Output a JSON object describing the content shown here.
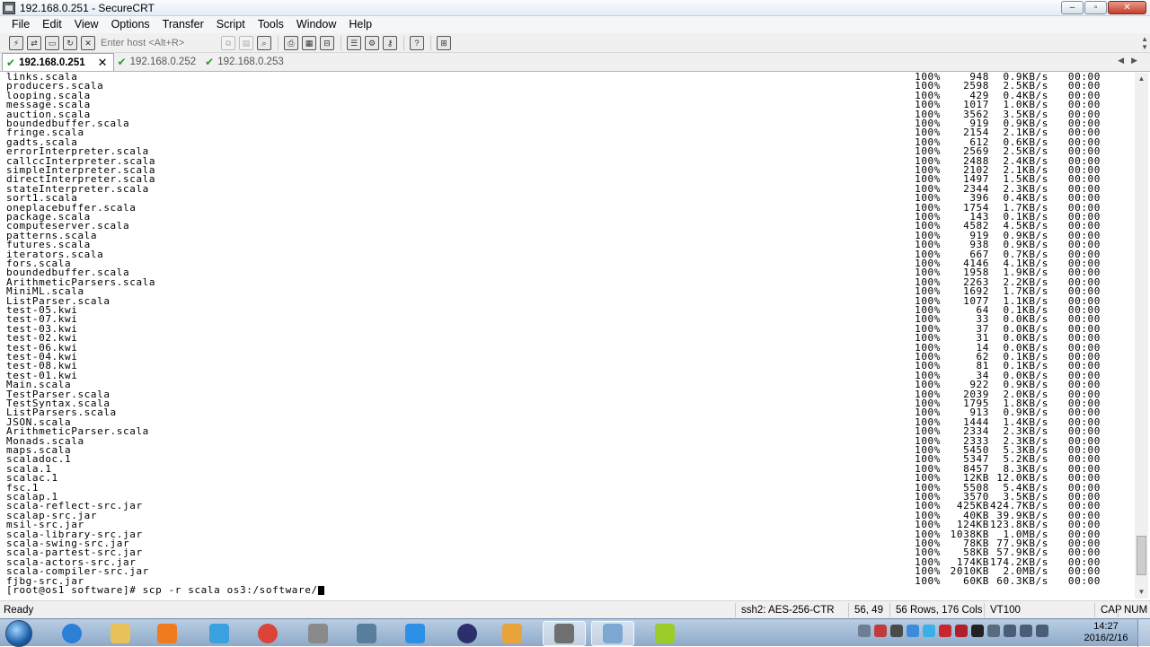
{
  "window": {
    "title": "192.168.0.251 - SecureCRT",
    "min": "–",
    "max": "▫",
    "close": "✕"
  },
  "menu": [
    "File",
    "Edit",
    "View",
    "Options",
    "Transfer",
    "Script",
    "Tools",
    "Window",
    "Help"
  ],
  "toolbar": {
    "host_placeholder": "Enter host <Alt+R>"
  },
  "tabs": [
    {
      "label": "192.168.0.251",
      "active": true
    },
    {
      "label": "192.168.0.252",
      "active": false
    },
    {
      "label": "192.168.0.253",
      "active": false
    }
  ],
  "terminal": {
    "rows": [
      {
        "file": "links.scala",
        "pct": "100%",
        "size": "948",
        "rate": "0.9KB/s",
        "eta": "00:00"
      },
      {
        "file": "producers.scala",
        "pct": "100%",
        "size": "2598",
        "rate": "2.5KB/s",
        "eta": "00:00"
      },
      {
        "file": "looping.scala",
        "pct": "100%",
        "size": "429",
        "rate": "0.4KB/s",
        "eta": "00:00"
      },
      {
        "file": "message.scala",
        "pct": "100%",
        "size": "1017",
        "rate": "1.0KB/s",
        "eta": "00:00"
      },
      {
        "file": "auction.scala",
        "pct": "100%",
        "size": "3562",
        "rate": "3.5KB/s",
        "eta": "00:00"
      },
      {
        "file": "boundedbuffer.scala",
        "pct": "100%",
        "size": "919",
        "rate": "0.9KB/s",
        "eta": "00:00"
      },
      {
        "file": "fringe.scala",
        "pct": "100%",
        "size": "2154",
        "rate": "2.1KB/s",
        "eta": "00:00"
      },
      {
        "file": "gadts.scala",
        "pct": "100%",
        "size": "612",
        "rate": "0.6KB/s",
        "eta": "00:00"
      },
      {
        "file": "errorInterpreter.scala",
        "pct": "100%",
        "size": "2569",
        "rate": "2.5KB/s",
        "eta": "00:00"
      },
      {
        "file": "callccInterpreter.scala",
        "pct": "100%",
        "size": "2488",
        "rate": "2.4KB/s",
        "eta": "00:00"
      },
      {
        "file": "simpleInterpreter.scala",
        "pct": "100%",
        "size": "2102",
        "rate": "2.1KB/s",
        "eta": "00:00"
      },
      {
        "file": "directInterpreter.scala",
        "pct": "100%",
        "size": "1497",
        "rate": "1.5KB/s",
        "eta": "00:00"
      },
      {
        "file": "stateInterpreter.scala",
        "pct": "100%",
        "size": "2344",
        "rate": "2.3KB/s",
        "eta": "00:00"
      },
      {
        "file": "sort1.scala",
        "pct": "100%",
        "size": "396",
        "rate": "0.4KB/s",
        "eta": "00:00"
      },
      {
        "file": "oneplacebuffer.scala",
        "pct": "100%",
        "size": "1754",
        "rate": "1.7KB/s",
        "eta": "00:00"
      },
      {
        "file": "package.scala",
        "pct": "100%",
        "size": "143",
        "rate": "0.1KB/s",
        "eta": "00:00"
      },
      {
        "file": "computeserver.scala",
        "pct": "100%",
        "size": "4582",
        "rate": "4.5KB/s",
        "eta": "00:00"
      },
      {
        "file": "patterns.scala",
        "pct": "100%",
        "size": "919",
        "rate": "0.9KB/s",
        "eta": "00:00"
      },
      {
        "file": "futures.scala",
        "pct": "100%",
        "size": "938",
        "rate": "0.9KB/s",
        "eta": "00:00"
      },
      {
        "file": "iterators.scala",
        "pct": "100%",
        "size": "667",
        "rate": "0.7KB/s",
        "eta": "00:00"
      },
      {
        "file": "fors.scala",
        "pct": "100%",
        "size": "4146",
        "rate": "4.1KB/s",
        "eta": "00:00"
      },
      {
        "file": "boundedbuffer.scala",
        "pct": "100%",
        "size": "1958",
        "rate": "1.9KB/s",
        "eta": "00:00"
      },
      {
        "file": "ArithmeticParsers.scala",
        "pct": "100%",
        "size": "2263",
        "rate": "2.2KB/s",
        "eta": "00:00"
      },
      {
        "file": "MiniML.scala",
        "pct": "100%",
        "size": "1692",
        "rate": "1.7KB/s",
        "eta": "00:00"
      },
      {
        "file": "ListParser.scala",
        "pct": "100%",
        "size": "1077",
        "rate": "1.1KB/s",
        "eta": "00:00"
      },
      {
        "file": "test-05.kwi",
        "pct": "100%",
        "size": "64",
        "rate": "0.1KB/s",
        "eta": "00:00"
      },
      {
        "file": "test-07.kwi",
        "pct": "100%",
        "size": "33",
        "rate": "0.0KB/s",
        "eta": "00:00"
      },
      {
        "file": "test-03.kwi",
        "pct": "100%",
        "size": "37",
        "rate": "0.0KB/s",
        "eta": "00:00"
      },
      {
        "file": "test-02.kwi",
        "pct": "100%",
        "size": "31",
        "rate": "0.0KB/s",
        "eta": "00:00"
      },
      {
        "file": "test-06.kwi",
        "pct": "100%",
        "size": "14",
        "rate": "0.0KB/s",
        "eta": "00:00"
      },
      {
        "file": "test-04.kwi",
        "pct": "100%",
        "size": "62",
        "rate": "0.1KB/s",
        "eta": "00:00"
      },
      {
        "file": "test-08.kwi",
        "pct": "100%",
        "size": "81",
        "rate": "0.1KB/s",
        "eta": "00:00"
      },
      {
        "file": "test-01.kwi",
        "pct": "100%",
        "size": "34",
        "rate": "0.0KB/s",
        "eta": "00:00"
      },
      {
        "file": "Main.scala",
        "pct": "100%",
        "size": "922",
        "rate": "0.9KB/s",
        "eta": "00:00"
      },
      {
        "file": "TestParser.scala",
        "pct": "100%",
        "size": "2039",
        "rate": "2.0KB/s",
        "eta": "00:00"
      },
      {
        "file": "TestSyntax.scala",
        "pct": "100%",
        "size": "1795",
        "rate": "1.8KB/s",
        "eta": "00:00"
      },
      {
        "file": "ListParsers.scala",
        "pct": "100%",
        "size": "913",
        "rate": "0.9KB/s",
        "eta": "00:00"
      },
      {
        "file": "JSON.scala",
        "pct": "100%",
        "size": "1444",
        "rate": "1.4KB/s",
        "eta": "00:00"
      },
      {
        "file": "ArithmeticParser.scala",
        "pct": "100%",
        "size": "2334",
        "rate": "2.3KB/s",
        "eta": "00:00"
      },
      {
        "file": "Monads.scala",
        "pct": "100%",
        "size": "2333",
        "rate": "2.3KB/s",
        "eta": "00:00"
      },
      {
        "file": "maps.scala",
        "pct": "100%",
        "size": "5450",
        "rate": "5.3KB/s",
        "eta": "00:00"
      },
      {
        "file": "scaladoc.1",
        "pct": "100%",
        "size": "5347",
        "rate": "5.2KB/s",
        "eta": "00:00"
      },
      {
        "file": "scala.1",
        "pct": "100%",
        "size": "8457",
        "rate": "8.3KB/s",
        "eta": "00:00"
      },
      {
        "file": "scalac.1",
        "pct": "100%",
        "size": "12KB",
        "rate": "12.0KB/s",
        "eta": "00:00"
      },
      {
        "file": "fsc.1",
        "pct": "100%",
        "size": "5508",
        "rate": "5.4KB/s",
        "eta": "00:00"
      },
      {
        "file": "scalap.1",
        "pct": "100%",
        "size": "3570",
        "rate": "3.5KB/s",
        "eta": "00:00"
      },
      {
        "file": "scala-reflect-src.jar",
        "pct": "100%",
        "size": "425KB",
        "rate": "424.7KB/s",
        "eta": "00:00"
      },
      {
        "file": "scalap-src.jar",
        "pct": "100%",
        "size": "40KB",
        "rate": "39.9KB/s",
        "eta": "00:00"
      },
      {
        "file": "msil-src.jar",
        "pct": "100%",
        "size": "124KB",
        "rate": "123.8KB/s",
        "eta": "00:00"
      },
      {
        "file": "scala-library-src.jar",
        "pct": "100%",
        "size": "1038KB",
        "rate": "1.0MB/s",
        "eta": "00:00"
      },
      {
        "file": "scala-swing-src.jar",
        "pct": "100%",
        "size": "78KB",
        "rate": "77.9KB/s",
        "eta": "00:00"
      },
      {
        "file": "scala-partest-src.jar",
        "pct": "100%",
        "size": "58KB",
        "rate": "57.9KB/s",
        "eta": "00:00"
      },
      {
        "file": "scala-actors-src.jar",
        "pct": "100%",
        "size": "174KB",
        "rate": "174.2KB/s",
        "eta": "00:00"
      },
      {
        "file": "scala-compiler-src.jar",
        "pct": "100%",
        "size": "2010KB",
        "rate": "2.0MB/s",
        "eta": "00:00"
      },
      {
        "file": "fjbg-src.jar",
        "pct": "100%",
        "size": "60KB",
        "rate": "60.3KB/s",
        "eta": "00:00"
      }
    ],
    "prompt": "[root@os1 software]# scp -r scala os3:/software/"
  },
  "status": {
    "ready": "Ready",
    "cipher": "ssh2: AES-256-CTR",
    "position": "56,  49",
    "size": "56 Rows, 176 Cols",
    "emulation": "VT100",
    "cap": "CAP",
    "num": "NUM"
  },
  "taskbar": {
    "apps": [
      {
        "name": "internet-explorer",
        "color": "#2b7fd6"
      },
      {
        "name": "file-explorer",
        "color": "#e8c15a"
      },
      {
        "name": "media-player",
        "color": "#f07b1f"
      },
      {
        "name": "network-app",
        "color": "#3aa0e0"
      },
      {
        "name": "chrome",
        "color": "#db4437"
      },
      {
        "name": "settings-app",
        "color": "#8a8a8a"
      },
      {
        "name": "security-app",
        "color": "#5a7f9e"
      },
      {
        "name": "feather-app",
        "color": "#2d8fe6"
      },
      {
        "name": "eclipse",
        "color": "#2c2f6b"
      },
      {
        "name": "virtualbox",
        "color": "#e8a33b"
      },
      {
        "name": "securecrt",
        "color": "#6f6f6f"
      },
      {
        "name": "network-drive",
        "color": "#7ba7d0"
      },
      {
        "name": "mybatis-app",
        "color": "#9ccc2a"
      }
    ],
    "time": "14:27",
    "date": "2016/2/16"
  }
}
